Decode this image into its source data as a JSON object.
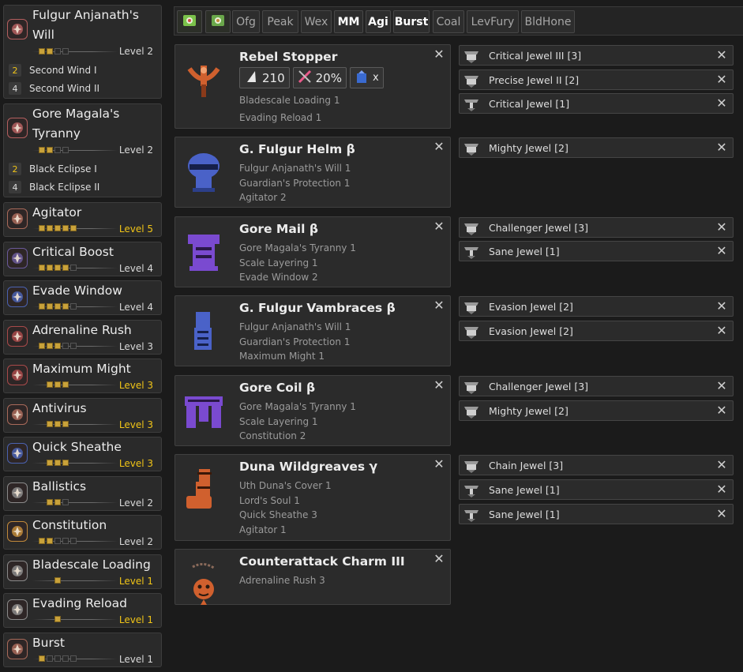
{
  "skills": [
    {
      "name": "Fulgur Anjanath's Will",
      "level": "Level 2",
      "pips_filled": 2,
      "pips_total": 4,
      "max": false,
      "icon": "set-bonus-icon",
      "color": "#b35f5f",
      "bonuses": [
        {
          "num": "2",
          "label": "Second Wind I"
        },
        {
          "num": "4",
          "label": "Second Wind II"
        }
      ]
    },
    {
      "name": "Gore Magala's Tyranny",
      "level": "Level 2",
      "pips_filled": 2,
      "pips_total": 4,
      "max": false,
      "icon": "set-bonus-icon",
      "color": "#b35f5f",
      "bonuses": [
        {
          "num": "2",
          "label": "Black Eclipse I"
        },
        {
          "num": "4",
          "label": "Black Eclipse II"
        }
      ]
    },
    {
      "name": "Agitator",
      "level": "Level 5",
      "pips_filled": 5,
      "pips_total": 5,
      "max": true,
      "icon": "agitator-icon",
      "color": "#a86a5a"
    },
    {
      "name": "Critical Boost",
      "level": "Level 4",
      "pips_filled": 4,
      "pips_total": 5,
      "max": false,
      "icon": "critical-boost-icon",
      "color": "#6a5a9a"
    },
    {
      "name": "Evade Window",
      "level": "Level 4",
      "pips_filled": 4,
      "pips_total": 5,
      "max": false,
      "icon": "evade-window-icon",
      "color": "#4a62b0"
    },
    {
      "name": "Adrenaline Rush",
      "level": "Level 3",
      "pips_filled": 3,
      "pips_total": 5,
      "max": false,
      "icon": "adrenaline-rush-icon",
      "color": "#a84a4a"
    },
    {
      "name": "Maximum Might",
      "level": "Level 3",
      "pips_filled": 3,
      "pips_total": 3,
      "max": true,
      "icon": "maximum-might-icon",
      "color": "#a84a4a"
    },
    {
      "name": "Antivirus",
      "level": "Level 3",
      "pips_filled": 3,
      "pips_total": 3,
      "max": true,
      "icon": "antivirus-icon",
      "color": "#a86a5a"
    },
    {
      "name": "Quick Sheathe",
      "level": "Level 3",
      "pips_filled": 3,
      "pips_total": 3,
      "max": true,
      "icon": "quick-sheathe-icon",
      "color": "#4a62b0"
    },
    {
      "name": "Ballistics",
      "level": "Level 2",
      "pips_filled": 2,
      "pips_total": 3,
      "max": false,
      "icon": "ballistics-icon",
      "color": "#8a8a8a"
    },
    {
      "name": "Constitution",
      "level": "Level 2",
      "pips_filled": 2,
      "pips_total": 5,
      "max": false,
      "icon": "constitution-icon",
      "color": "#c0893a"
    },
    {
      "name": "Bladescale Loading",
      "level": "Level 1",
      "pips_filled": 1,
      "pips_total": 1,
      "max": true,
      "icon": "bladescale-loading-icon",
      "color": "#8a8a8a"
    },
    {
      "name": "Evading Reload",
      "level": "Level 1",
      "pips_filled": 1,
      "pips_total": 1,
      "max": true,
      "icon": "evading-reload-icon",
      "color": "#8a8a8a"
    },
    {
      "name": "Burst",
      "level": "Level 1",
      "pips_filled": 1,
      "pips_total": 5,
      "max": false,
      "icon": "burst-icon",
      "color": "#a86a5a"
    }
  ],
  "filters": [
    {
      "label": "",
      "icon": "bowgun-filter-icon",
      "active": false
    },
    {
      "label": "",
      "icon": "armor-filter-icon",
      "active": false
    },
    {
      "label": "Ofg",
      "active": false
    },
    {
      "label": "Peak",
      "active": false
    },
    {
      "label": "Wex",
      "active": false
    },
    {
      "label": "MM",
      "active": true
    },
    {
      "label": "Agi",
      "active": true
    },
    {
      "label": "Burst",
      "active": true
    },
    {
      "label": "Coal",
      "active": false
    },
    {
      "label": "LevFury",
      "active": false
    },
    {
      "label": "BldHone",
      "active": false
    }
  ],
  "equipment": [
    {
      "name": "Rebel Stopper",
      "type": "weapon",
      "color": "#d0602e",
      "stats": {
        "attack": "210",
        "affinity": "20%",
        "element": "x"
      },
      "skills": [
        "Bladescale Loading 1",
        "Evading Reload 1"
      ],
      "jewels": [
        "Critical Jewel III [3]",
        "Precise Jewel II [2]",
        "Critical Jewel [1]"
      ]
    },
    {
      "name": "G. Fulgur Helm β",
      "type": "helm",
      "color": "#4a62c8",
      "skills": [
        "Fulgur Anjanath's Will 1",
        "Guardian's Protection 1",
        "Agitator 2"
      ],
      "jewels": [
        "Mighty Jewel [2]"
      ]
    },
    {
      "name": "Gore Mail β",
      "type": "chest",
      "color": "#7a4ad0",
      "skills": [
        "Gore Magala's Tyranny 1",
        "Scale Layering 1",
        "Evade Window 2"
      ],
      "jewels": [
        "Challenger Jewel [3]",
        "Sane Jewel [1]"
      ]
    },
    {
      "name": "G. Fulgur Vambraces β",
      "type": "arms",
      "color": "#4a62c8",
      "skills": [
        "Fulgur Anjanath's Will 1",
        "Guardian's Protection 1",
        "Maximum Might 1"
      ],
      "jewels": [
        "Evasion Jewel [2]",
        "Evasion Jewel [2]"
      ]
    },
    {
      "name": "Gore Coil β",
      "type": "waist",
      "color": "#7a4ad0",
      "skills": [
        "Gore Magala's Tyranny 1",
        "Scale Layering 1",
        "Constitution 2"
      ],
      "jewels": [
        "Challenger Jewel [3]",
        "Mighty Jewel [2]"
      ]
    },
    {
      "name": "Duna Wildgreaves γ",
      "type": "legs",
      "color": "#d0602e",
      "skills": [
        "Uth Duna's Cover 1",
        "Lord's Soul 1",
        "Quick Sheathe 3",
        "Agitator 1"
      ],
      "jewels": [
        "Chain Jewel [3]",
        "Sane Jewel [1]",
        "Sane Jewel [1]"
      ]
    },
    {
      "name": "Counterattack Charm III",
      "type": "charm",
      "color": "#d0602e",
      "skills": [
        "Adrenaline Rush 3"
      ],
      "jewels": []
    }
  ],
  "close_glyph": "✕"
}
